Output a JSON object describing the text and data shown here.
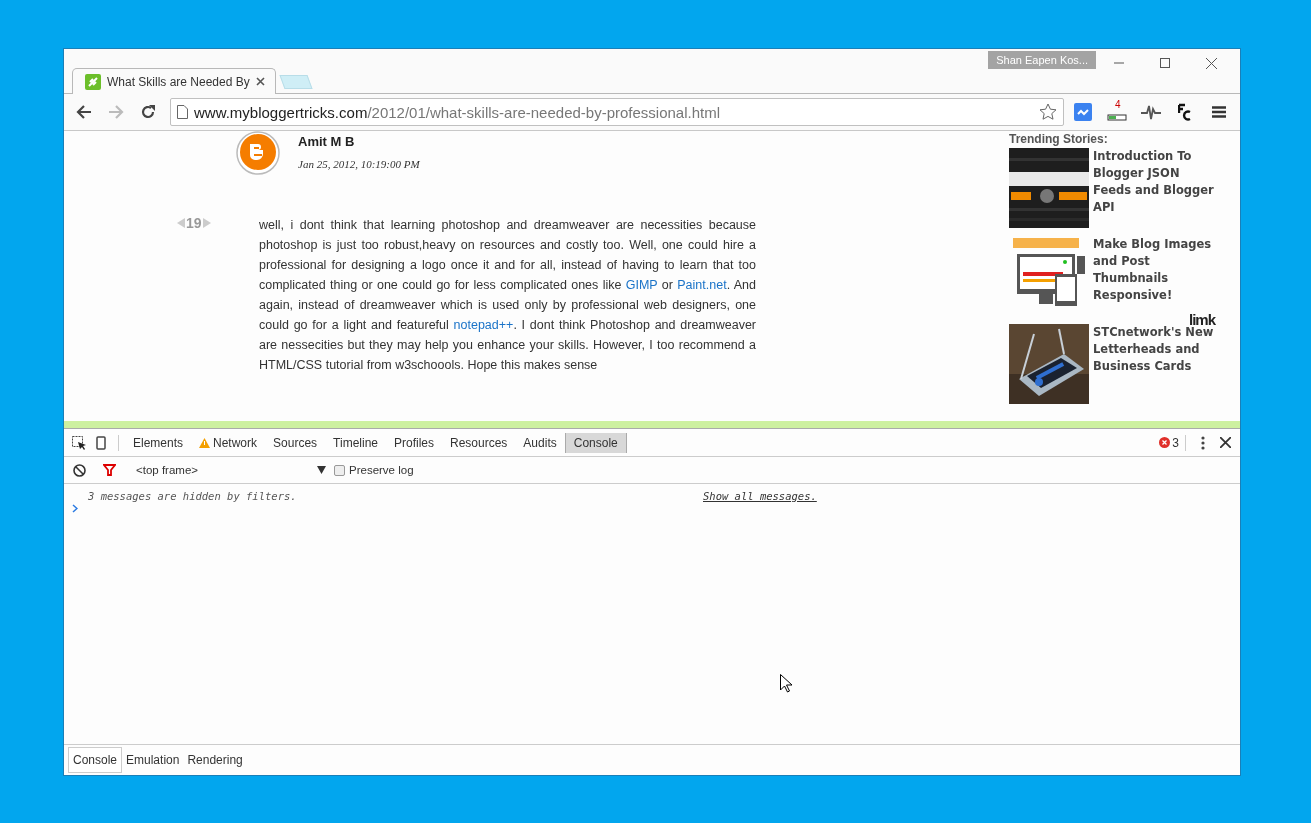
{
  "window": {
    "profile": "Shan Eapen Kos..."
  },
  "tabs": [
    {
      "title": "What Skills are Needed By",
      "selected": true
    }
  ],
  "address": {
    "domain": "www.mybloggertricks.com",
    "path": "/2012/01/what-skills-are-needed-by-professional.html"
  },
  "extension_badge": "4",
  "comment": {
    "author": "Amit M B",
    "date": "Jan 25, 2012, 10:19:00 PM",
    "vote_count": "19",
    "body": [
      {
        "text": "well, i dont think that learning photoshop and dreamweaver are necessities because photoshop is just too robust,heavy on resources and costly too. Well, one could hire a professional for designing a logo once it and for all, instead of having to learn that too complicated thing or one could go for less complicated ones like ",
        "kind": "text"
      },
      {
        "text": "GIMP",
        "kind": "link"
      },
      {
        "text": " or ",
        "kind": "text"
      },
      {
        "text": "Paint.net",
        "kind": "link"
      },
      {
        "text": ". And again, instead of dreamweaver which is used only by professional web designers, one could go for a light and featureful ",
        "kind": "text"
      },
      {
        "text": "notepad++",
        "kind": "link"
      },
      {
        "text": ". I dont think Photoshop and dreamweaver are nessecities but they may help you enhance your skills. However, I too recommend a HTML/CSS tutorial from w3schoools. Hope this makes sense",
        "kind": "text"
      }
    ]
  },
  "trending": {
    "title": "Trending Stories:",
    "stories": [
      {
        "title": "Introduction To Blogger JSON Feeds and Blogger API",
        "kind": "picture"
      },
      {
        "title": "Make Blog Images and Post Thumbnails Responsive!",
        "kind": "picture"
      },
      {
        "title": "STCnetwork's New Letterheads and Business Cards",
        "kind": "picture"
      }
    ],
    "brand": "limk"
  },
  "devtools": {
    "tabs": [
      {
        "label": "Elements",
        "selected": false,
        "warning": false
      },
      {
        "label": "Network",
        "selected": false,
        "warning": true
      },
      {
        "label": "Sources",
        "selected": false,
        "warning": false
      },
      {
        "label": "Timeline",
        "selected": false,
        "warning": false
      },
      {
        "label": "Profiles",
        "selected": false,
        "warning": false
      },
      {
        "label": "Resources",
        "selected": false,
        "warning": false
      },
      {
        "label": "Audits",
        "selected": false,
        "warning": false
      },
      {
        "label": "Console",
        "selected": true,
        "warning": false
      }
    ],
    "error_count": "3",
    "frame": "<top frame>",
    "preserve_log": {
      "label": "Preserve log",
      "checked": false
    },
    "hidden_note": "3 messages are hidden by filters.",
    "show_all": "Show all messages.",
    "drawer_tabs": [
      {
        "label": "Console",
        "selected": true
      },
      {
        "label": "Emulation",
        "selected": false
      },
      {
        "label": "Rendering",
        "selected": false
      }
    ]
  }
}
